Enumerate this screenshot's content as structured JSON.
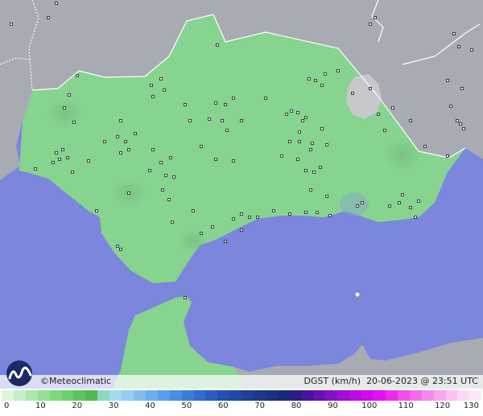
{
  "map": {
    "brand": "Meteoclimatic",
    "copyright": "©Meteoclimatic",
    "variable": "DGST (km/h)",
    "timestamp": "20-06-2023 @ 23:51 UTC",
    "colors": {
      "sea": "#7b86dc",
      "land_outside": "#a9abb2",
      "land_region": "#86d48f",
      "high_terrain": "#c8c8cc",
      "border": "#ffffff",
      "station": "#1a1a1a"
    }
  },
  "legend": {
    "ticks": [
      "0",
      "10",
      "20",
      "30",
      "40",
      "50",
      "60",
      "70",
      "80",
      "90",
      "100",
      "110",
      "120",
      "130"
    ],
    "colors": [
      "#ddf7dd",
      "#c5f0c5",
      "#ace8ac",
      "#94e094",
      "#7fd87f",
      "#6ecf6e",
      "#5cc45c",
      "#50bb50",
      "#8fd8c0",
      "#a4dcef",
      "#93cdf2",
      "#80bef0",
      "#6cafee",
      "#5a9ee9",
      "#4b8de0",
      "#3d7cd6",
      "#336ccb",
      "#2a5cbf",
      "#2550b0",
      "#2147a3",
      "#1f3f96",
      "#1c378a",
      "#1a3180",
      "#192b78",
      "#2c1c86",
      "#48169c",
      "#6712b3",
      "#8410c6",
      "#a00cd8",
      "#bc0ae6",
      "#d30af0",
      "#e510f0",
      "#ef2bea",
      "#f24de8",
      "#f46ce9",
      "#f68aec",
      "#f8a6ef",
      "#fac1f3",
      "#fcdaf7",
      "#fde9f9"
    ]
  }
}
